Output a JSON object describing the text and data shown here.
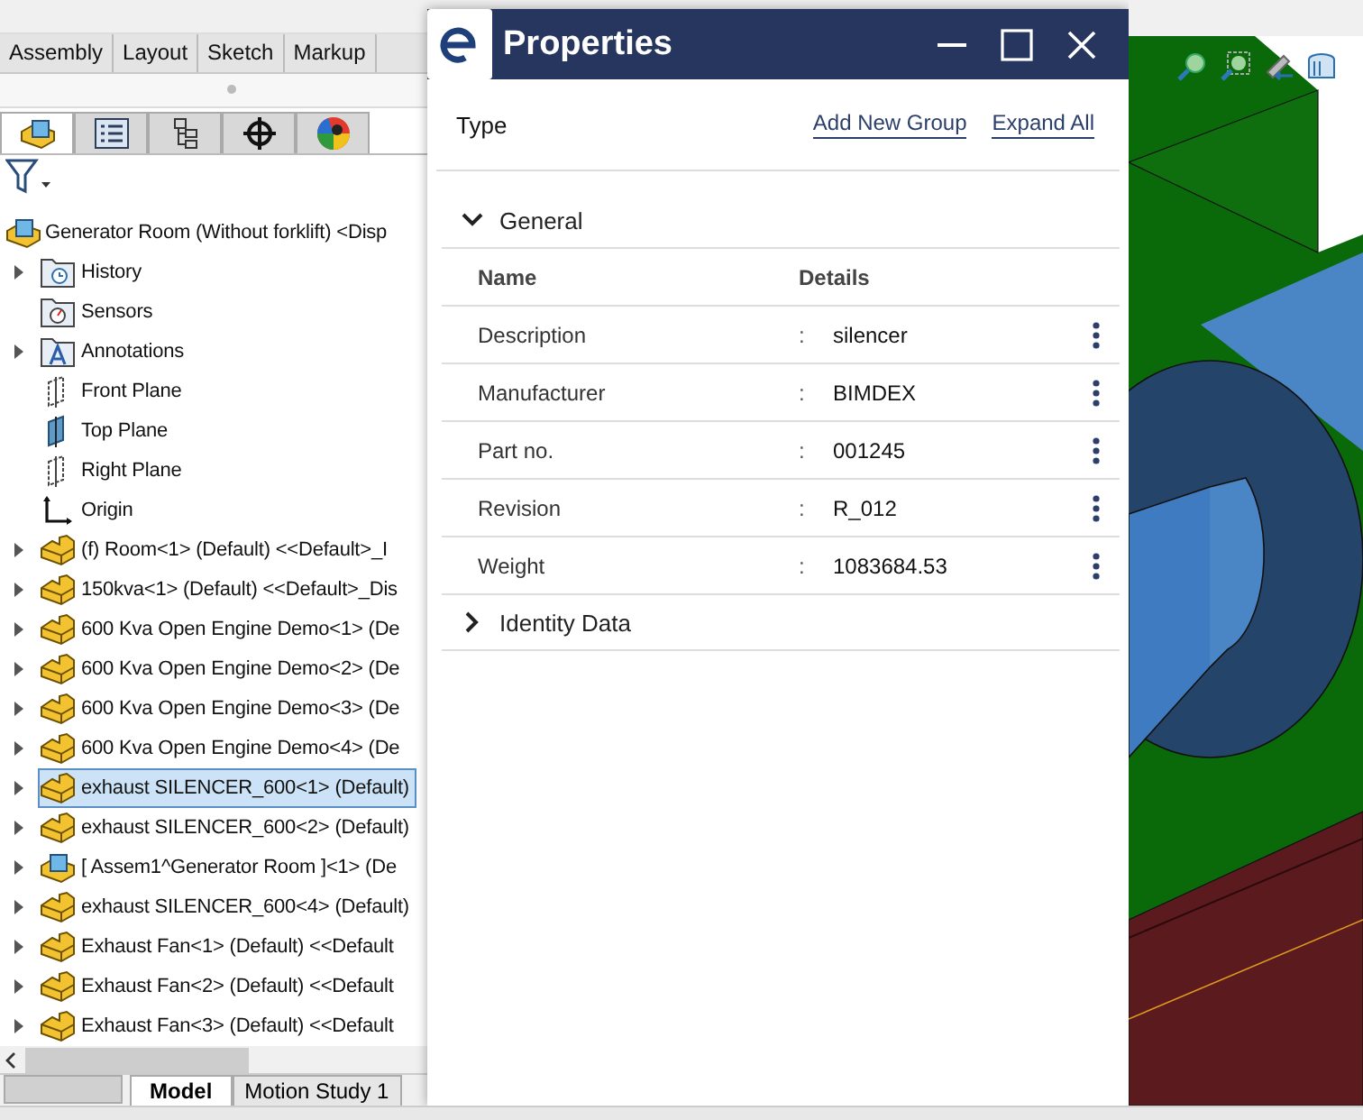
{
  "command_tabs": [
    {
      "label": "Assembly",
      "selected": false
    },
    {
      "label": "Layout",
      "selected": false
    },
    {
      "label": "Sketch",
      "selected": false
    },
    {
      "label": "Markup",
      "selected": false
    }
  ],
  "manager_tabs": [
    {
      "kind": "feature-tree",
      "selected": true
    },
    {
      "kind": "property",
      "selected": false
    },
    {
      "kind": "config",
      "selected": false
    },
    {
      "kind": "dimxpert",
      "selected": false
    },
    {
      "kind": "display",
      "selected": false
    }
  ],
  "tree": {
    "label": "Generator Room (Without forklift) <Disp",
    "kind": "subassembly",
    "selected": false,
    "children": [
      {
        "label": "History",
        "kind": "history",
        "expandable": true,
        "selected": false
      },
      {
        "label": "Sensors",
        "kind": "sensors",
        "expandable": false,
        "selected": false
      },
      {
        "label": "Annotations",
        "kind": "annotations",
        "expandable": true,
        "selected": false
      },
      {
        "label": "Front Plane",
        "kind": "plane",
        "expandable": false,
        "selected": false
      },
      {
        "label": "Top Plane",
        "kind": "plane-filled",
        "expandable": false,
        "selected": false
      },
      {
        "label": "Right Plane",
        "kind": "plane",
        "expandable": false,
        "selected": false
      },
      {
        "label": "Origin",
        "kind": "origin",
        "expandable": false,
        "selected": false
      },
      {
        "label": "(f) Room<1> (Default) <<Default>_I",
        "kind": "component",
        "expandable": true,
        "selected": false
      },
      {
        "label": "150kva<1> (Default) <<Default>_Dis",
        "kind": "component",
        "expandable": true,
        "selected": false
      },
      {
        "label": "600 Kva Open Engine Demo<1> (De",
        "kind": "component",
        "expandable": true,
        "selected": false
      },
      {
        "label": "600 Kva Open Engine Demo<2> (De",
        "kind": "component",
        "expandable": true,
        "selected": false
      },
      {
        "label": "600 Kva Open Engine Demo<3> (De",
        "kind": "component",
        "expandable": true,
        "selected": false
      },
      {
        "label": "600 Kva Open Engine Demo<4> (De",
        "kind": "component",
        "expandable": true,
        "selected": false
      },
      {
        "label": "exhaust SILENCER_600<1> (Default)",
        "kind": "component",
        "expandable": true,
        "selected": true
      },
      {
        "label": "exhaust SILENCER_600<2> (Default)",
        "kind": "component",
        "expandable": true,
        "selected": false
      },
      {
        "label": "[ Assem1^Generator Room ]<1> (De",
        "kind": "subassembly",
        "expandable": true,
        "selected": false
      },
      {
        "label": "exhaust SILENCER_600<4> (Default)",
        "kind": "component",
        "expandable": true,
        "selected": false
      },
      {
        "label": "Exhaust Fan<1> (Default) <<Default",
        "kind": "component",
        "expandable": true,
        "selected": false
      },
      {
        "label": "Exhaust Fan<2> (Default) <<Default",
        "kind": "component",
        "expandable": true,
        "selected": false
      },
      {
        "label": "Exhaust Fan<3> (Default) <<Default",
        "kind": "component",
        "expandable": true,
        "selected": false
      }
    ]
  },
  "bottom_tabs": [
    {
      "label": "Model",
      "selected": true
    },
    {
      "label": "Motion Study 1",
      "selected": false
    }
  ],
  "properties": {
    "title": "Properties",
    "type_label": "Type",
    "links": [
      "Add New Group",
      "Expand All"
    ],
    "groups": [
      {
        "title": "General",
        "expanded": true,
        "columns": [
          "Name",
          "Details"
        ],
        "rows": [
          {
            "name": "Description",
            "separator": ":",
            "value": "silencer"
          },
          {
            "name": "Manufacturer",
            "separator": ":",
            "value": "BIMDEX"
          },
          {
            "name": "Part no.",
            "separator": ":",
            "value": "001245"
          },
          {
            "name": "Revision",
            "separator": ":",
            "value": "R_012"
          },
          {
            "name": "Weight",
            "separator": ":",
            "value": "1083684.53"
          }
        ]
      },
      {
        "title": "Identity Data",
        "expanded": false
      }
    ]
  }
}
